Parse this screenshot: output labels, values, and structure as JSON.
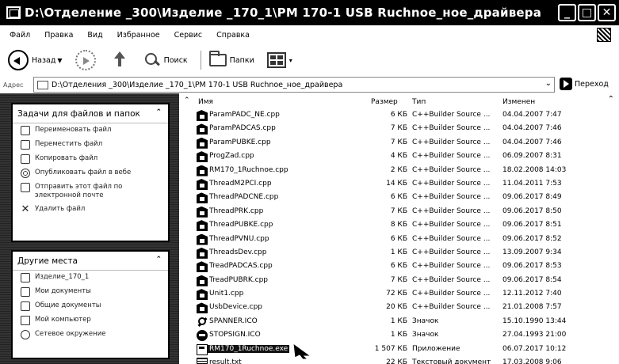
{
  "window": {
    "title": "D:\\Отделение _300\\Изделие _170_1\\PM 170-1 USB Ruchnoe_ноe_драйвера"
  },
  "menu": {
    "items": [
      "Файл",
      "Правка",
      "Вид",
      "Избранное",
      "Сервис",
      "Справка"
    ]
  },
  "toolbar": {
    "back": "Назад",
    "search": "Поиск",
    "folders": "Папки"
  },
  "address": {
    "label": "Адрес",
    "path": "D:\\Отделения _300\\Изделие _170_1\\PM 170-1 USB Ruchnoe_ноe_драйвера",
    "go": "Переход"
  },
  "tasks_panel": {
    "title": "Задачи для файлов и папок",
    "items": [
      {
        "label": "Переименовать файл",
        "icon": "rename-icon"
      },
      {
        "label": "Переместить файл",
        "icon": "move-icon"
      },
      {
        "label": "Копировать файл",
        "icon": "copy-icon"
      },
      {
        "label": "Опубликовать файл в вебе",
        "icon": "publish-web-icon"
      },
      {
        "label": "Отправить этот файл по электронной почте",
        "icon": "email-icon"
      },
      {
        "label": "Удалить файл",
        "icon": "delete-icon"
      }
    ]
  },
  "places_panel": {
    "title": "Другие места",
    "items": [
      {
        "label": "Изделие_170_1",
        "icon": "folder-icon"
      },
      {
        "label": "Мои документы",
        "icon": "my-documents-icon"
      },
      {
        "label": "Общие документы",
        "icon": "shared-documents-icon"
      },
      {
        "label": "Мой компьютер",
        "icon": "my-computer-icon"
      },
      {
        "label": "Сетевое окружение",
        "icon": "network-icon"
      }
    ]
  },
  "file_list": {
    "headers": {
      "name": "Имя",
      "size": "Размер",
      "type": "Тип",
      "date": "Изменен"
    },
    "files": [
      {
        "name": "ParamPADC_NE.cpp",
        "size": "6 КБ",
        "type": "C++Builder Source ...",
        "date": "04.04.2007 7:47",
        "icon": "cpp"
      },
      {
        "name": "ParamPADCAS.cpp",
        "size": "7 КБ",
        "type": "C++Builder Source ...",
        "date": "04.04.2007 7:46",
        "icon": "cpp"
      },
      {
        "name": "ParamPUBKE.cpp",
        "size": "7 КБ",
        "type": "C++Builder Source ...",
        "date": "04.04.2007 7:46",
        "icon": "cpp"
      },
      {
        "name": "ProgZad.cpp",
        "size": "4 КБ",
        "type": "C++Builder Source ...",
        "date": "06.09.2007 8:31",
        "icon": "cpp"
      },
      {
        "name": "RM170_1Ruchnoe.cpp",
        "size": "2 КБ",
        "type": "C++Builder Source ...",
        "date": "18.02.2008 14:03",
        "icon": "cpp"
      },
      {
        "name": "ThreadM2PCI.cpp",
        "size": "14 КБ",
        "type": "C++Builder Source ...",
        "date": "11.04.2011 7:53",
        "icon": "cpp"
      },
      {
        "name": "ThreadPADCNE.cpp",
        "size": "6 КБ",
        "type": "C++Builder Source ...",
        "date": "09.06.2017 8:49",
        "icon": "cpp"
      },
      {
        "name": "ThreadPRK.cpp",
        "size": "7 КБ",
        "type": "C++Builder Source ...",
        "date": "09.06.2017 8:50",
        "icon": "cpp"
      },
      {
        "name": "ThreadPUBKE.cpp",
        "size": "8 КБ",
        "type": "C++Builder Source ...",
        "date": "09.06.2017 8:51",
        "icon": "cpp"
      },
      {
        "name": "ThreadPVNU.cpp",
        "size": "6 КБ",
        "type": "C++Builder Source ...",
        "date": "09.06.2017 8:52",
        "icon": "cpp"
      },
      {
        "name": "ThreadsDev.cpp",
        "size": "1 КБ",
        "type": "C++Builder Source ...",
        "date": "13.09.2007 9:34",
        "icon": "cpp"
      },
      {
        "name": "TreadPADCAS.cpp",
        "size": "6 КБ",
        "type": "C++Builder Source ...",
        "date": "09.06.2017 8:53",
        "icon": "cpp"
      },
      {
        "name": "TreadPUBRK.cpp",
        "size": "7 КБ",
        "type": "C++Builder Source ...",
        "date": "09.06.2017 8:54",
        "icon": "cpp"
      },
      {
        "name": "Unit1.cpp",
        "size": "72 КБ",
        "type": "C++Builder Source ...",
        "date": "12.11.2012 7:40",
        "icon": "cpp"
      },
      {
        "name": "UsbDevice.cpp",
        "size": "20 КБ",
        "type": "C++Builder Source ...",
        "date": "21.01.2008 7:57",
        "icon": "cpp"
      },
      {
        "name": "SPANNER.ICO",
        "size": "1 КБ",
        "type": "Значок",
        "date": "15.10.1990 13:44",
        "icon": "spanner"
      },
      {
        "name": "STOPSIGN.ICO",
        "size": "1 КБ",
        "type": "Значок",
        "date": "27.04.1993 21:00",
        "icon": "stop"
      },
      {
        "name": "RM170_1Ruchnoe.exe",
        "size": "1 507 КБ",
        "type": "Приложение",
        "date": "06.07.2017 10:12",
        "icon": "exe",
        "selected": true
      },
      {
        "name": "result.txt",
        "size": "22 КБ",
        "type": "Текстовый документ",
        "date": "17.03.2008 9:06",
        "icon": "txt"
      }
    ]
  }
}
